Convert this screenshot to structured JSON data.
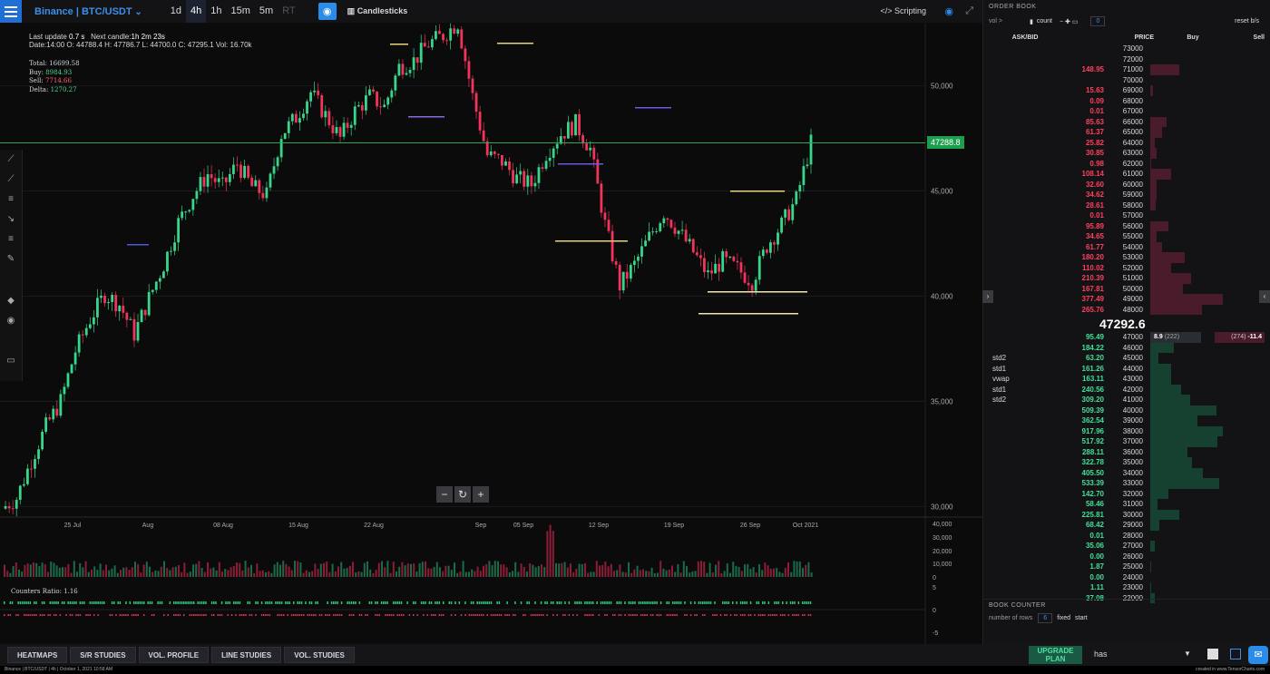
{
  "header": {
    "symbol": "Binance | BTC/USDT",
    "timeframes": [
      "1d",
      "4h",
      "1h",
      "15m",
      "5m",
      "RT"
    ],
    "active_tf": "4h",
    "chart_type": "Candlesticks",
    "scripting": "</> Scripting"
  },
  "info": {
    "last_update_label": "Last update",
    "last_update": "0.7 s",
    "next_candle_label": "Next candle:",
    "next_candle": "1h 2m 23s",
    "ohlc": "Date:14:00 O: 44788.4 H: 47786.7 L: 44700.0 C: 47295.1 Vol: 16.70k"
  },
  "stats": {
    "total": "16699.58",
    "buy": "8984.93",
    "sell": "7714.66",
    "delta": "1270.27"
  },
  "price_tag": "47288.8",
  "counters_ratio": "Counters Ratio: 1.16",
  "chart_data": {
    "type": "line",
    "x_labels": [
      "25 Jul",
      "Aug",
      "08 Aug",
      "15 Aug",
      "22 Aug",
      "Sep",
      "05 Sep",
      "12 Sep",
      "19 Sep",
      "26 Sep",
      "Oct 2021"
    ],
    "y_ticks": [
      "50,000",
      "45,000",
      "40,000",
      "35,000",
      "30,000"
    ],
    "ylim": [
      29500,
      53000
    ],
    "close_path": [
      29900,
      30400,
      32200,
      33800,
      35000,
      37400,
      38900,
      40100,
      39600,
      38200,
      39900,
      41500,
      43500,
      44800,
      45800,
      45200,
      46300,
      45200,
      44800,
      47700,
      48500,
      49700,
      48600,
      47500,
      48800,
      49500,
      49000,
      50900,
      51200,
      52000,
      52400,
      53000,
      49500,
      46700,
      46400,
      45600,
      45300,
      46800,
      47700,
      48200,
      47000,
      43400,
      40500,
      41500,
      42800,
      44000,
      43100,
      42100,
      41000,
      41700,
      41300,
      40700,
      42400,
      43400,
      44600,
      47290
    ],
    "volume_ticks": [
      "40,000",
      "30,000",
      "20,000",
      "10,000",
      "0"
    ],
    "counter_ticks": [
      "5",
      "0",
      "-5"
    ]
  },
  "toolbar_bottom": [
    "HEATMAPS",
    "S/R STUDIES",
    "VOL. PROFILE",
    "LINE STUDIES",
    "VOL. STUDIES"
  ],
  "upgrade": [
    "UPGRADE",
    "PLAN"
  ],
  "search_value": "has",
  "footer_left": "Binance | BTC/USDT | 4h | October 1, 2021 10:58 AM",
  "footer_right": "created in www.TensorCharts.com",
  "orderbook": {
    "title": "ORDER BOOK",
    "vol_label": "vol >",
    "count_label": "count",
    "count_value": "0",
    "reset": "reset b/s",
    "headers": {
      "askbid": "ASK/BID",
      "price": "PRICE",
      "buy": "Buy",
      "sell": "Sell"
    },
    "asks": [
      {
        "p": "73000",
        "v": ""
      },
      {
        "p": "72000",
        "v": ""
      },
      {
        "p": "71000",
        "v": "148.95"
      },
      {
        "p": "70000",
        "v": ""
      },
      {
        "p": "69000",
        "v": "15.63"
      },
      {
        "p": "68000",
        "v": "0.09"
      },
      {
        "p": "67000",
        "v": "0.01"
      },
      {
        "p": "66000",
        "v": "85.63"
      },
      {
        "p": "65000",
        "v": "61.37"
      },
      {
        "p": "64000",
        "v": "25.82"
      },
      {
        "p": "63000",
        "v": "30.85"
      },
      {
        "p": "62000",
        "v": "0.98"
      },
      {
        "p": "61000",
        "v": "108.14"
      },
      {
        "p": "60000",
        "v": "32.60"
      },
      {
        "p": "59000",
        "v": "34.62"
      },
      {
        "p": "58000",
        "v": "28.61"
      },
      {
        "p": "57000",
        "v": "0.01"
      },
      {
        "p": "56000",
        "v": "95.89"
      },
      {
        "p": "55000",
        "v": "34.65"
      },
      {
        "p": "54000",
        "v": "61.77"
      },
      {
        "p": "53000",
        "v": "180.20"
      },
      {
        "p": "52000",
        "v": "110.02"
      },
      {
        "p": "51000",
        "v": "210.39"
      },
      {
        "p": "50000",
        "v": "167.81"
      },
      {
        "p": "49000",
        "v": "377.49"
      },
      {
        "p": "48000",
        "v": "265.76"
      }
    ],
    "mid_price": "47292.6",
    "bids": [
      {
        "p": "47000",
        "v": "95.49",
        "lab": ""
      },
      {
        "p": "46000",
        "v": "184.22",
        "lab": ""
      },
      {
        "p": "45000",
        "v": "63.20",
        "lab": "std2"
      },
      {
        "p": "44000",
        "v": "161.26",
        "lab": "std1"
      },
      {
        "p": "43000",
        "v": "163.11",
        "lab": "vwap"
      },
      {
        "p": "42000",
        "v": "240.56",
        "lab": "std1"
      },
      {
        "p": "41000",
        "v": "309.20",
        "lab": "std2"
      },
      {
        "p": "40000",
        "v": "509.39",
        "lab": ""
      },
      {
        "p": "39000",
        "v": "362.54",
        "lab": ""
      },
      {
        "p": "38000",
        "v": "917.96",
        "lab": ""
      },
      {
        "p": "37000",
        "v": "517.92",
        "lab": ""
      },
      {
        "p": "36000",
        "v": "288.11",
        "lab": ""
      },
      {
        "p": "35000",
        "v": "322.78",
        "lab": ""
      },
      {
        "p": "34000",
        "v": "405.50",
        "lab": ""
      },
      {
        "p": "33000",
        "v": "533.39",
        "lab": ""
      },
      {
        "p": "32000",
        "v": "142.70",
        "lab": ""
      },
      {
        "p": "31000",
        "v": "58.46",
        "lab": ""
      },
      {
        "p": "30000",
        "v": "225.81",
        "lab": ""
      },
      {
        "p": "29000",
        "v": "68.42",
        "lab": ""
      },
      {
        "p": "28000",
        "v": "0.01",
        "lab": ""
      },
      {
        "p": "27000",
        "v": "35.06",
        "lab": ""
      },
      {
        "p": "26000",
        "v": "0.00",
        "lab": ""
      },
      {
        "p": "25000",
        "v": "1.87",
        "lab": ""
      },
      {
        "p": "24000",
        "v": "0.00",
        "lab": ""
      },
      {
        "p": "23000",
        "v": "1.11",
        "lab": ""
      },
      {
        "p": "22000",
        "v": "37.08",
        "lab": ""
      }
    ],
    "buy_trade": "8.9",
    "buy_count": "(222)",
    "sell_count": "(274)",
    "sell_trade": "-11.4",
    "counter_title": "BOOK COUNTER",
    "rows_label": "number of rows",
    "rows_value": "6",
    "fixed": "fixed",
    "start": "start",
    "colors": {
      "ask": "#ff3f5f",
      "bid": "#3fe098",
      "askbar": "#4a1b2a",
      "bidbar": "#16402f"
    }
  }
}
